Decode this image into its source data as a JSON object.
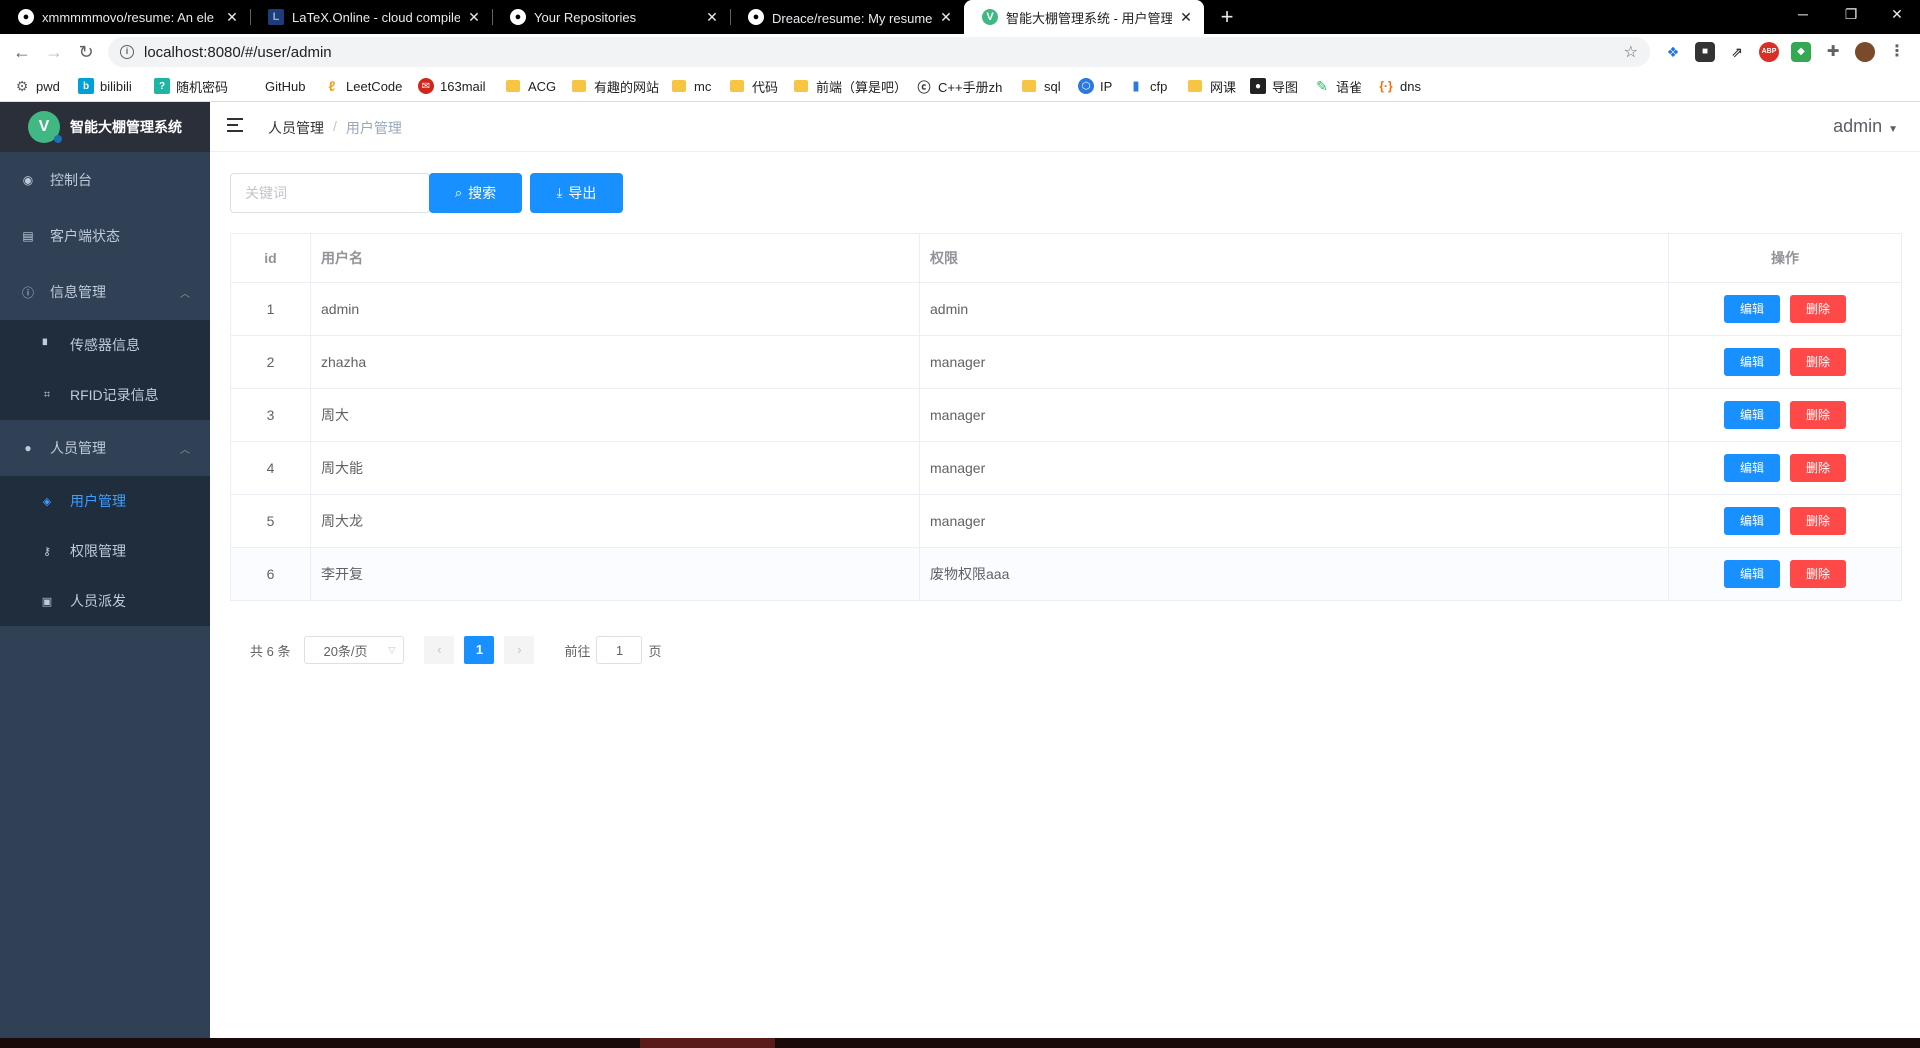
{
  "browser": {
    "tabs": [
      {
        "title": "xmmmmmovo/resume: An ele",
        "icon": "github-icon",
        "active": false
      },
      {
        "title": "LaTeX.Online - cloud compiler",
        "icon": "latex-icon",
        "active": false
      },
      {
        "title": "Your Repositories",
        "icon": "github-icon",
        "active": false
      },
      {
        "title": "Dreace/resume: My resume/个",
        "icon": "github-icon",
        "active": false
      },
      {
        "title": "智能大棚管理系统 - 用户管理",
        "icon": "vue-icon",
        "active": true
      }
    ],
    "url": "localhost:8080/#/user/admin",
    "bookmarks": [
      {
        "label": "pwd",
        "icon": "gear-icon"
      },
      {
        "label": "bilibili",
        "icon": "bilibili-icon"
      },
      {
        "label": "随机密码",
        "icon": "password-icon"
      },
      {
        "label": "GitHub",
        "icon": "github-icon"
      },
      {
        "label": "LeetCode",
        "icon": "leetcode-icon"
      },
      {
        "label": "163mail",
        "icon": "mail-icon"
      },
      {
        "label": "ACG",
        "icon": "folder-icon"
      },
      {
        "label": "有趣的网站",
        "icon": "folder-icon"
      },
      {
        "label": "mc",
        "icon": "folder-icon"
      },
      {
        "label": "代码",
        "icon": "folder-icon"
      },
      {
        "label": "前端（算是吧）",
        "icon": "folder-icon"
      },
      {
        "label": "C++手册zh",
        "icon": "cpp-icon"
      },
      {
        "label": "sql",
        "icon": "folder-icon"
      },
      {
        "label": "IP",
        "icon": "ip-icon"
      },
      {
        "label": "cfp",
        "icon": "chart-icon"
      },
      {
        "label": "网课",
        "icon": "folder-icon"
      },
      {
        "label": "导图",
        "icon": "mindmap-icon"
      },
      {
        "label": "语雀",
        "icon": "yuque-icon"
      },
      {
        "label": "dns",
        "icon": "dns-icon"
      }
    ]
  },
  "app": {
    "logo_title": "智能大棚管理系统",
    "logo_letter": "V",
    "menu": {
      "dashboard": "控制台",
      "client_status": "客户端状态",
      "info_mgmt": "信息管理",
      "sensor_info": "传感器信息",
      "rfid_info": "RFID记录信息",
      "staff_mgmt": "人员管理",
      "user_mgmt": "用户管理",
      "perm_mgmt": "权限管理",
      "staff_dispatch": "人员派发"
    },
    "breadcrumb": [
      "人员管理",
      "用户管理"
    ],
    "username": "admin",
    "search": {
      "placeholder": "关键词",
      "search_label": "搜索",
      "export_label": "导出"
    },
    "table": {
      "headers": {
        "id": "id",
        "username": "用户名",
        "permission": "权限",
        "actions": "操作"
      },
      "edit_label": "编辑",
      "delete_label": "删除",
      "rows": [
        {
          "id": "1",
          "username": "admin",
          "permission": "admin"
        },
        {
          "id": "2",
          "username": "zhazha",
          "permission": "manager"
        },
        {
          "id": "3",
          "username": "周大",
          "permission": "manager"
        },
        {
          "id": "4",
          "username": "周大能",
          "permission": "manager"
        },
        {
          "id": "5",
          "username": "周大龙",
          "permission": "manager"
        },
        {
          "id": "6",
          "username": "李开复",
          "permission": "废物权限aaa"
        }
      ]
    },
    "pagination": {
      "total_text": "共 6 条",
      "page_size": "20条/页",
      "current_page": "1",
      "goto_label": "前往",
      "goto_value": "1",
      "page_suffix": "页"
    }
  },
  "colors": {
    "sidebar_bg": "#304156",
    "primary": "#1890ff",
    "danger": "#ff4949",
    "active_menu": "#409eff"
  }
}
